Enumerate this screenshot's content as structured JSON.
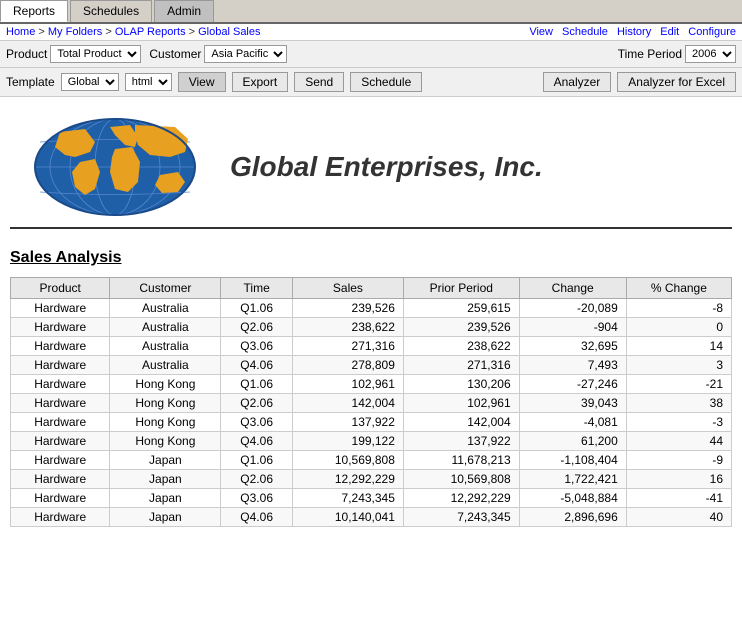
{
  "tabs": [
    {
      "label": "Reports",
      "active": true
    },
    {
      "label": "Schedules",
      "active": false
    },
    {
      "label": "Admin",
      "active": false
    }
  ],
  "breadcrumb": {
    "items": [
      "Home",
      "My Folders",
      "OLAP Reports",
      "Global Sales"
    ]
  },
  "top_links": [
    "View",
    "Schedule",
    "History",
    "Edit",
    "Configure"
  ],
  "filters": {
    "product_label": "Product",
    "product_value": "Total Product",
    "customer_label": "Customer",
    "customer_value": "Asia Pacific",
    "time_period_label": "Time Period",
    "time_period_value": "2006"
  },
  "toolbar": {
    "template_label": "Template",
    "template_value": "Global",
    "format_value": "html",
    "view_label": "View",
    "export_label": "Export",
    "send_label": "Send",
    "schedule_label": "Schedule",
    "analyzer_label": "Analyzer",
    "analyzer_excel_label": "Analyzer for Excel"
  },
  "report": {
    "company_name": "Global Enterprises, Inc.",
    "section_title": "Sales Analysis"
  },
  "table": {
    "headers": [
      "Product",
      "Customer",
      "Time",
      "Sales",
      "Prior Period",
      "Change",
      "% Change"
    ],
    "rows": [
      [
        "Hardware",
        "Australia",
        "Q1.06",
        "239,526",
        "259,615",
        "-20,089",
        "-8"
      ],
      [
        "Hardware",
        "Australia",
        "Q2.06",
        "238,622",
        "239,526",
        "-904",
        "0"
      ],
      [
        "Hardware",
        "Australia",
        "Q3.06",
        "271,316",
        "238,622",
        "32,695",
        "14"
      ],
      [
        "Hardware",
        "Australia",
        "Q4.06",
        "278,809",
        "271,316",
        "7,493",
        "3"
      ],
      [
        "Hardware",
        "Hong Kong",
        "Q1.06",
        "102,961",
        "130,206",
        "-27,246",
        "-21"
      ],
      [
        "Hardware",
        "Hong Kong",
        "Q2.06",
        "142,004",
        "102,961",
        "39,043",
        "38"
      ],
      [
        "Hardware",
        "Hong Kong",
        "Q3.06",
        "137,922",
        "142,004",
        "-4,081",
        "-3"
      ],
      [
        "Hardware",
        "Hong Kong",
        "Q4.06",
        "199,122",
        "137,922",
        "61,200",
        "44"
      ],
      [
        "Hardware",
        "Japan",
        "Q1.06",
        "10,569,808",
        "11,678,213",
        "-1,108,404",
        "-9"
      ],
      [
        "Hardware",
        "Japan",
        "Q2.06",
        "12,292,229",
        "10,569,808",
        "1,722,421",
        "16"
      ],
      [
        "Hardware",
        "Japan",
        "Q3.06",
        "7,243,345",
        "12,292,229",
        "-5,048,884",
        "-41"
      ],
      [
        "Hardware",
        "Japan",
        "Q4.06",
        "10,140,041",
        "7,243,345",
        "2,896,696",
        "40"
      ]
    ]
  }
}
